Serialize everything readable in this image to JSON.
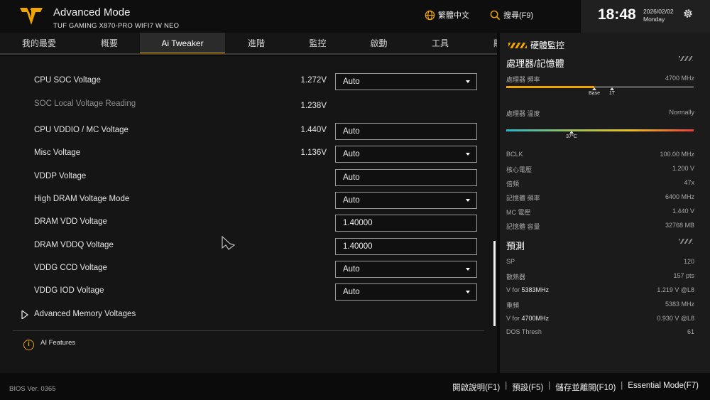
{
  "header": {
    "title": "Advanced Mode",
    "subtitle": "TUF GAMING X870-PRO WIFI7 W NEO",
    "language_label": "繁體中文",
    "search_label": "搜尋(F9)",
    "time": "18:48",
    "date": "2026/02/02",
    "weekday": "Monday"
  },
  "tabs": [
    {
      "label": "我的最愛"
    },
    {
      "label": "概要"
    },
    {
      "label": "Ai Tweaker",
      "active": true
    },
    {
      "label": "進階"
    },
    {
      "label": "監控"
    },
    {
      "label": "啟動"
    },
    {
      "label": "工具"
    },
    {
      "label": "離"
    }
  ],
  "settings": [
    {
      "label": "CPU SOC Voltage",
      "reading": "1.272V",
      "value": "Auto",
      "control": "dropdown"
    },
    {
      "label": "SOC Local Voltage Reading",
      "reading": "1.238V",
      "control": "none",
      "dim": true
    },
    {
      "label": "CPU VDDIO / MC Voltage",
      "reading": "1.440V",
      "value": "Auto",
      "control": "text"
    },
    {
      "label": "Misc Voltage",
      "reading": "1.136V",
      "value": "Auto",
      "control": "dropdown"
    },
    {
      "label": "VDDP Voltage",
      "reading": "",
      "value": "Auto",
      "control": "text"
    },
    {
      "label": "High DRAM Voltage Mode",
      "reading": "",
      "value": "Auto",
      "control": "dropdown"
    },
    {
      "label": "DRAM VDD Voltage",
      "reading": "",
      "value": "1.40000",
      "control": "text"
    },
    {
      "label": "DRAM VDDQ Voltage",
      "reading": "",
      "value": "1.40000",
      "control": "text"
    },
    {
      "label": "VDDG CCD Voltage",
      "reading": "",
      "value": "Auto",
      "control": "dropdown"
    },
    {
      "label": "VDDG IOD Voltage",
      "reading": "",
      "value": "Auto",
      "control": "dropdown"
    }
  ],
  "submenu": {
    "label": "Advanced Memory Voltages"
  },
  "info": {
    "text": "AI Features"
  },
  "monitor": {
    "heading": "硬體監控",
    "cpu_mem_title": "處理器/記憶體",
    "cpu_freq_label": "處理器 頻率",
    "cpu_freq_value": "4700 MHz",
    "cpu_freq_level": 0.47,
    "freq_marker_base": "Base",
    "freq_marker_1t": "1T",
    "cpu_temp_label": "處理器 溫度",
    "cpu_temp_value": "Normally",
    "temp_marker": "37°C",
    "rows": [
      {
        "label": "BCLK",
        "value": "100.00 MHz"
      },
      {
        "label": "核心電壓",
        "value": "1.200 V"
      },
      {
        "label": "倍頻",
        "value": "47x"
      },
      {
        "label": "記憶體 頻率",
        "value": "6400 MHz"
      },
      {
        "label": "MC 電壓",
        "value": "1.440 V"
      },
      {
        "label": "記憶體 容量",
        "value": "32768 MB"
      }
    ],
    "predict_title": "預測",
    "predict_rows": [
      {
        "label": "SP",
        "value": "120"
      },
      {
        "label": "散熱器",
        "value": "157 pts"
      },
      {
        "label_prefix": "V for ",
        "label_freq": "5383MHz",
        "value": "1.219 V @L8"
      },
      {
        "label": "重頻",
        "value": "5383 MHz"
      },
      {
        "label_prefix": "V for ",
        "label_freq": "4700MHz",
        "value": "0.930 V @L8"
      },
      {
        "label": "DOS Thresh",
        "value": "61"
      }
    ]
  },
  "footer": {
    "bios_version": "BIOS Ver. 0365",
    "keys": [
      "開啟說明(F1)",
      "預設(F5)",
      "儲存並離開(F10)",
      "Essential Mode(F7)"
    ]
  },
  "colors": {
    "accent": "#f0a400",
    "background": "#151515",
    "panel": "#1b1b1b"
  }
}
